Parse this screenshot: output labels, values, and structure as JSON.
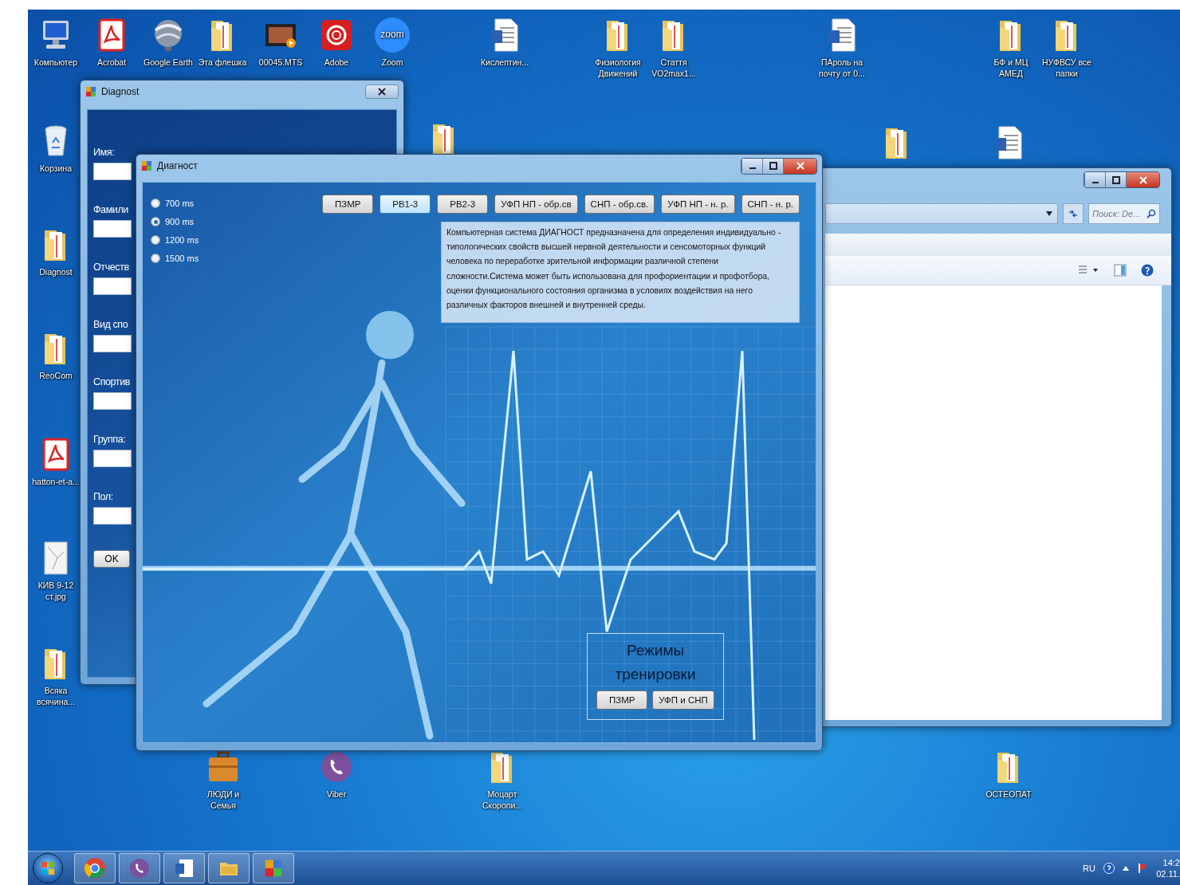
{
  "desktop": {
    "top_icons": [
      {
        "label": "Компьютер",
        "kind": "computer"
      },
      {
        "label": "Acrobat",
        "kind": "pdf"
      },
      {
        "label": "Google Earth",
        "kind": "globe"
      },
      {
        "label": "Эта флешка",
        "kind": "folder"
      },
      {
        "label": "00045.MTS",
        "kind": "video"
      },
      {
        "label": "Adobe",
        "kind": "adobe"
      },
      {
        "label": "Zoom",
        "kind": "zoom",
        "badge": "zoom"
      },
      {
        "label": "Кислептин...",
        "kind": "word"
      },
      {
        "label": "Физиология Движений",
        "kind": "folder"
      },
      {
        "label": "Стаття VO2max1...",
        "kind": "folder"
      },
      {
        "label": "ПАроль на почту от 0...",
        "kind": "word"
      },
      {
        "label": "БФ и МЦ АМЕД",
        "kind": "folder"
      },
      {
        "label": "НУФВСУ все папки",
        "kind": "folder"
      }
    ],
    "left_icons": [
      {
        "label": "Корзина",
        "kind": "trash"
      },
      {
        "label": "Diagnost",
        "kind": "folder"
      },
      {
        "label": "ReoCom",
        "kind": "folder"
      },
      {
        "label": "hatton-et-a...",
        "kind": "pdf"
      },
      {
        "label": "КИВ 9-12 ст.jpg",
        "kind": "image"
      },
      {
        "label": "Всяка всячина...",
        "kind": "folder"
      }
    ],
    "bottom_icons": [
      {
        "label": "ЛЮДИ и Семья",
        "kind": "briefcase"
      },
      {
        "label": "Viber",
        "kind": "viber"
      },
      {
        "label": "Моцарт Скоропи...",
        "kind": "folder"
      },
      {
        "label": "ОСТЕОПАТ",
        "kind": "folder"
      }
    ],
    "unlabeled_icons": [
      {
        "kind": "folder"
      },
      {
        "kind": "folder"
      },
      {
        "kind": "word"
      }
    ]
  },
  "diagnost_window": {
    "title": "Diagnost",
    "fields": [
      {
        "label": "Имя:"
      },
      {
        "label": "Фамили"
      },
      {
        "label": "Отчеств"
      },
      {
        "label": "Вид спо"
      },
      {
        "label": "Спортив"
      },
      {
        "label": "Группа:"
      },
      {
        "label": "Пол:"
      }
    ],
    "ok_button": "OK"
  },
  "main_window": {
    "title": "Диагност",
    "radios": [
      {
        "label": "700 ms",
        "selected": false
      },
      {
        "label": "900 ms",
        "selected": true
      },
      {
        "label": "1200 ms",
        "selected": false
      },
      {
        "label": "1500 ms",
        "selected": false
      }
    ],
    "tests": [
      {
        "label": "ПЗМР",
        "selected": false
      },
      {
        "label": "РВ1-3",
        "selected": true
      },
      {
        "label": "РВ2-3",
        "selected": false
      },
      {
        "label": "УФП НП - обр.св",
        "selected": false
      },
      {
        "label": "СНП - обр.св.",
        "selected": false
      },
      {
        "label": "УФП НП - н. р.",
        "selected": false
      },
      {
        "label": "СНП - н. р.",
        "selected": false
      }
    ],
    "description": "Компьютерная система ДИАГНОСТ предназначена для определения индивидуально - типологических свойств высшей нервной деятельности и сенсомоторных функций человека по переработке зрительной информации различной степени сложности.Система может быть использована для профориентации и профотбора, оценки функционального состояния организма в условиях воздействия на него различных факторов внешней и внутренней среды.",
    "training": {
      "title": "Режимы тренировки",
      "buttons": [
        "ПЗМР",
        "УФП и СНП"
      ]
    }
  },
  "explorer_window": {
    "search_placeholder": "Поиск: De..."
  },
  "taskbar": {
    "apps": [
      {
        "kind": "chrome"
      },
      {
        "kind": "viber"
      },
      {
        "kind": "word"
      },
      {
        "kind": "explorer"
      },
      {
        "kind": "app"
      }
    ],
    "language": "RU",
    "time": "14:2",
    "date": "02.11."
  }
}
